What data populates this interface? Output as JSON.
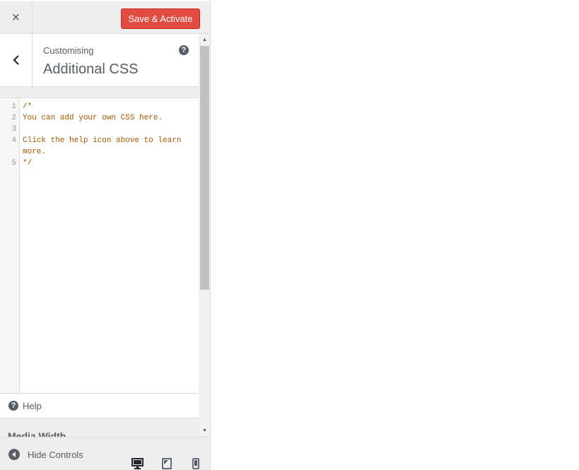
{
  "header": {
    "close_label": "×",
    "save_label": "Save & Activate"
  },
  "section": {
    "breadcrumb": "Customising",
    "title": "Additional CSS",
    "help_glyph": "?"
  },
  "editor": {
    "line_numbers": [
      "1",
      "2",
      "3",
      "4",
      "5"
    ],
    "lines": [
      "/*",
      "You can add your own CSS here.",
      "",
      "Click the help icon above to learn",
      "more.",
      "*/"
    ]
  },
  "help_row": {
    "label": "Help",
    "glyph": "?"
  },
  "media_width": {
    "label": "Media Width"
  },
  "footer": {
    "hide_label": "Hide Controls",
    "devices": [
      "desktop-icon",
      "tablet-icon",
      "mobile-icon"
    ]
  },
  "colors": {
    "accent": "#e14d43",
    "code": "#aa5500",
    "panel_bg": "#eeeeee"
  }
}
